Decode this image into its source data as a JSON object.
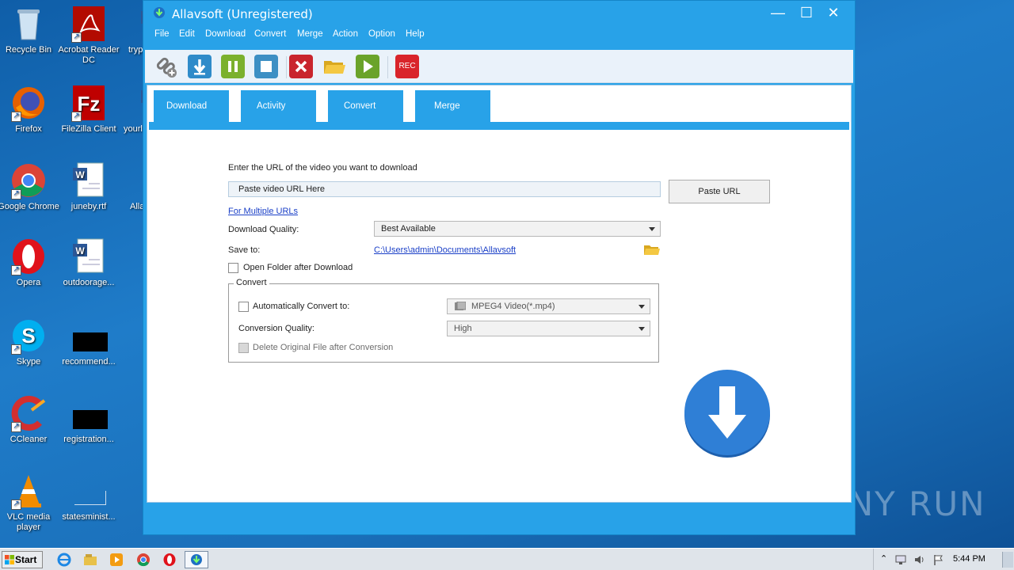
{
  "desktop": {
    "icons": [
      {
        "label": "Recycle Bin"
      },
      {
        "label": "Acrobat Reader DC"
      },
      {
        "label": "trypro"
      },
      {
        "label": "Firefox"
      },
      {
        "label": "FileZilla Client"
      },
      {
        "label": "yourl"
      },
      {
        "label": "Google Chrome"
      },
      {
        "label": "juneby.rtf"
      },
      {
        "label": "Alla"
      },
      {
        "label": "Opera"
      },
      {
        "label": "outdoorage..."
      },
      {
        "label": "Skype"
      },
      {
        "label": "recommend..."
      },
      {
        "label": "CCleaner"
      },
      {
        "label": "registration..."
      },
      {
        "label": "VLC media player"
      },
      {
        "label": "statesminist..."
      }
    ],
    "watermark": "ANY RUN"
  },
  "window": {
    "title": "Allavsoft (Unregistered)",
    "controls": {
      "minimize": "—",
      "maximize": "☐",
      "close": "✕"
    },
    "menu": [
      "File",
      "Edit",
      "Download",
      "Convert",
      "Merge",
      "Action",
      "Option",
      "Help"
    ],
    "toolbar": {
      "icons": [
        "add-link-icon",
        "download-icon",
        "pause-icon",
        "stop-icon",
        "delete-icon",
        "open-folder-icon",
        "play-icon",
        "rec-icon"
      ],
      "rec_label": "REC"
    },
    "tabs": [
      "Download",
      "Activity",
      "Convert",
      "Merge"
    ],
    "active_tab": "Download",
    "form": {
      "url_prompt": "Enter the URL of the video you want to download",
      "url_value": "Paste video URL Here",
      "paste_button": "Paste URL",
      "multiple_urls_link": "For Multiple URLs",
      "quality_label": "Download Quality:",
      "quality_value": "Best Available",
      "save_to_label": "Save to:",
      "save_to_path": "C:\\Users\\admin\\Documents\\Allavsoft",
      "open_folder_label": "Open Folder after Download",
      "convert_group": "Convert",
      "auto_convert_label": "Automatically Convert to:",
      "auto_convert_value": "MPEG4 Video(*.mp4)",
      "conversion_quality_label": "Conversion Quality:",
      "conversion_quality_value": "High",
      "delete_original_label": "Delete Original File after Conversion"
    }
  },
  "taskbar": {
    "start_label": "Start",
    "time": "5:44 PM"
  },
  "colors": {
    "window_blue": "#28a2e8",
    "big_button_blue": "#2f7fd6"
  }
}
